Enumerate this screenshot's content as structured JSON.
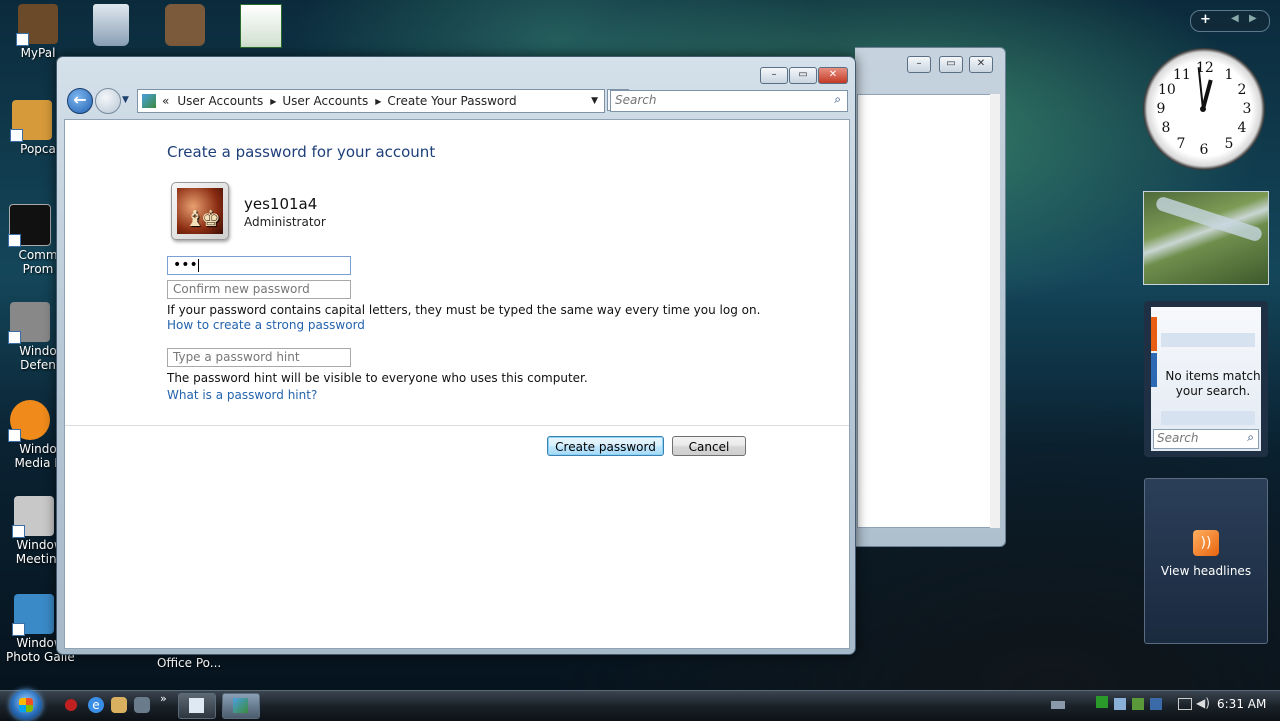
{
  "desktop": {
    "icons": [
      {
        "label": "MyPal",
        "color": "#6b4a2a"
      },
      {
        "label": "Popca",
        "color": "#d69a3a"
      },
      {
        "label": "Comm",
        "label2": "Prom",
        "color": "#111111"
      },
      {
        "label": "Windo",
        "label2": "Defen",
        "color": "#888888"
      },
      {
        "label": "Windo",
        "label2": "Media P",
        "color": "#f08a1a"
      },
      {
        "label": "Window",
        "label2": "Meetin..",
        "color": "#c8c8c8"
      },
      {
        "label": "Window",
        "label2": "Photo Gallery",
        "color": "#3a8ac8"
      },
      {
        "label": "Office Po...",
        "color": "#2a6a2a"
      }
    ]
  },
  "window": {
    "breadcrumb": [
      "User Accounts",
      "User Accounts",
      "Create Your Password"
    ],
    "breadcrumb_chevron": "«",
    "search_placeholder": "Search",
    "buttons": {
      "minimize": "–",
      "maximize": "▭",
      "close": "✕"
    }
  },
  "form": {
    "title": "Create a password for your account",
    "username": "yes101a4",
    "role": "Administrator",
    "new_password_value": "•••",
    "confirm_placeholder": "Confirm new password",
    "caps_note": "If your password contains capital letters, they must be typed the same way every time you log on.",
    "strong_link": "How to create a strong password",
    "hint_placeholder": "Type a password hint",
    "hint_note": "The password hint will be visible to everyone who uses this computer.",
    "hint_link": "What is a password hint?",
    "create_button": "Create password",
    "cancel_button": "Cancel"
  },
  "sidebar": {
    "clock_numbers": [
      "12",
      "1",
      "2",
      "3",
      "4",
      "5",
      "6",
      "7",
      "8",
      "9",
      "10",
      "11"
    ],
    "feeds_message": "No items match your search.",
    "feeds_search_placeholder": "Search",
    "headlines_label": "View headlines",
    "add_gadget": "+"
  },
  "taskbar": {
    "time": "6:31 AM"
  }
}
